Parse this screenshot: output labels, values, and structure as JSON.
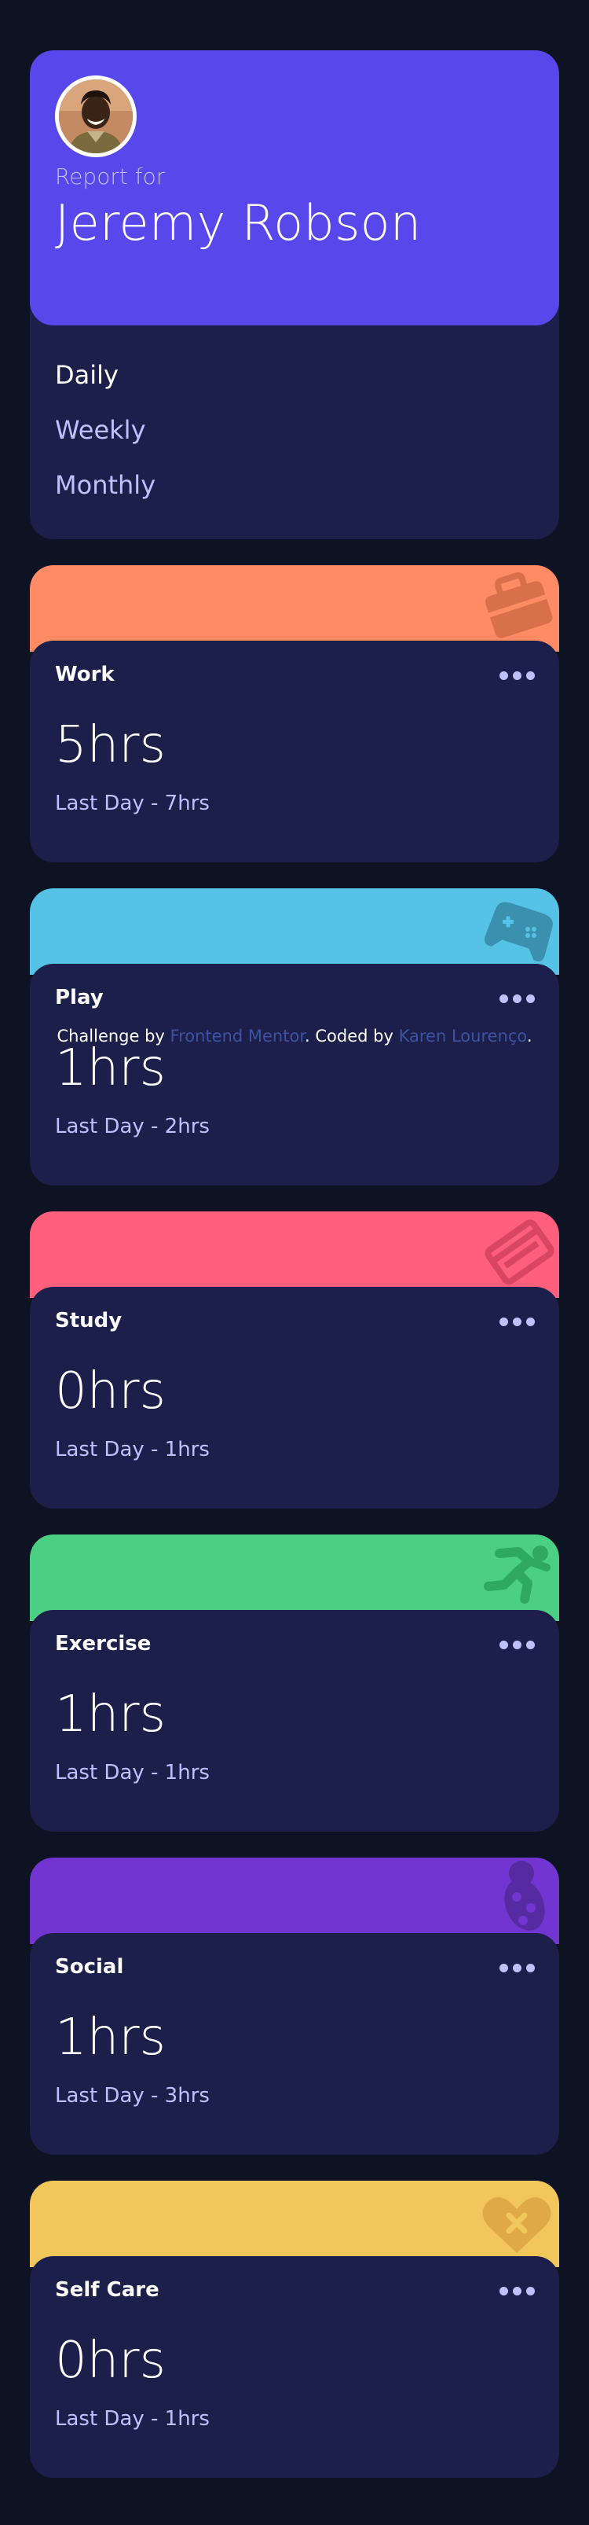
{
  "profile": {
    "report_for": "Report for",
    "name": "Jeremy Robson",
    "periods": [
      {
        "label": "Daily",
        "active": true
      },
      {
        "label": "Weekly",
        "active": false
      },
      {
        "label": "Monthly",
        "active": false
      }
    ]
  },
  "cards": [
    {
      "title": "Work",
      "current": "5hrs",
      "previous": "Last Day - 7hrs",
      "color": "#ff8b64",
      "icon": "briefcase-icon"
    },
    {
      "title": "Play",
      "current": "1hrs",
      "previous": "Last Day - 2hrs",
      "color": "#55c2e6",
      "icon": "gamepad-icon"
    },
    {
      "title": "Study",
      "current": "0hrs",
      "previous": "Last Day - 1hrs",
      "color": "#ff5e7d",
      "icon": "book-icon"
    },
    {
      "title": "Exercise",
      "current": "1hrs",
      "previous": "Last Day - 1hrs",
      "color": "#4bcf82",
      "icon": "runner-icon"
    },
    {
      "title": "Social",
      "current": "1hrs",
      "previous": "Last Day - 3hrs",
      "color": "#7335d2",
      "icon": "social-icon"
    },
    {
      "title": "Self Care",
      "current": "0hrs",
      "previous": "Last Day - 1hrs",
      "color": "#f1c75b",
      "icon": "heart-bandage-icon"
    }
  ],
  "attribution": {
    "prefix": "Challenge by ",
    "link1": "Frontend Mentor",
    "middle": ". Coded by ",
    "link2": "Karen Lourenço",
    "suffix": "."
  }
}
